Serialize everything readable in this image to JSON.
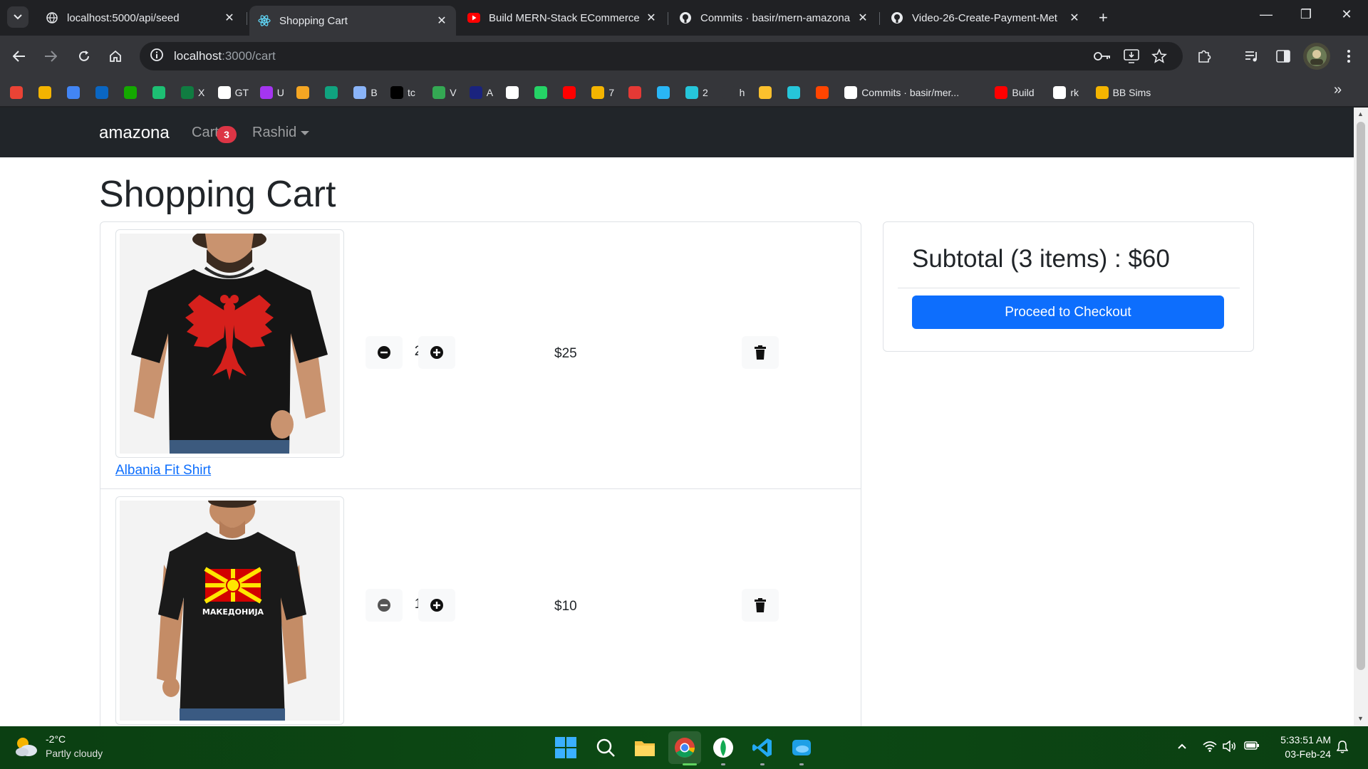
{
  "browser": {
    "tabs": [
      {
        "title": "localhost:5000/api/seed",
        "active": false,
        "icon": "globe-icon"
      },
      {
        "title": "Shopping Cart",
        "active": true,
        "icon": "react-icon"
      },
      {
        "title": "Build MERN-Stack ECommerce",
        "active": false,
        "icon": "youtube-icon"
      },
      {
        "title": "Commits · basir/mern-amazona",
        "active": false,
        "icon": "github-icon"
      },
      {
        "title": "Video-26-Create-Payment-Met",
        "active": false,
        "icon": "github-icon"
      }
    ],
    "url_host": "localhost",
    "url_path": ":3000/cart",
    "bookmarks": [
      {
        "label": "",
        "icon": "gmail-icon",
        "color": "#ea4335"
      },
      {
        "label": "",
        "icon": "photos-icon",
        "color": "#f4b400"
      },
      {
        "label": "",
        "icon": "drive-icon",
        "color": "#4285f4"
      },
      {
        "label": "",
        "icon": "linkedin-icon",
        "color": "#0a66c2"
      },
      {
        "label": "",
        "icon": "upwork-icon",
        "color": "#14a800"
      },
      {
        "label": "",
        "icon": "fiverr-icon",
        "color": "#1dbf73"
      },
      {
        "label": "X",
        "icon": "excel-icon",
        "color": "#107c41"
      },
      {
        "label": "GT",
        "icon": "google-icon",
        "color": "#ffffff"
      },
      {
        "label": "U",
        "icon": "udemy-icon",
        "color": "#a435f0"
      },
      {
        "label": "",
        "icon": "coursera-icon",
        "color": "#f5a623"
      },
      {
        "label": "",
        "icon": "chatgpt-icon",
        "color": "#10a37f"
      },
      {
        "label": "B",
        "icon": "gemini-icon",
        "color": "#8ab4f8"
      },
      {
        "label": "tc",
        "icon": "tc-icon",
        "color": "#000000"
      },
      {
        "label": "V",
        "icon": "download-icon",
        "color": "#34a853"
      },
      {
        "label": "A",
        "icon": "a-icon",
        "color": "#1a237e"
      },
      {
        "label": "",
        "icon": "circle-icon",
        "color": "#ffffff"
      },
      {
        "label": "",
        "icon": "whatsapp-icon",
        "color": "#25d366"
      },
      {
        "label": "",
        "icon": "youtube-icon",
        "color": "#ff0000"
      },
      {
        "label": "7",
        "icon": "play-box-icon",
        "color": "#f4b400"
      },
      {
        "label": "",
        "icon": "play-red-icon",
        "color": "#e53935"
      },
      {
        "label": "",
        "icon": "play-blue-icon",
        "color": "#29b6f6"
      },
      {
        "label": "2",
        "icon": "play-cyan-icon",
        "color": "#26c6da"
      },
      {
        "label": "h",
        "icon": "script-icon",
        "color": "#35363a"
      },
      {
        "label": "",
        "icon": "coin-icon",
        "color": "#fbc02d"
      },
      {
        "label": "",
        "icon": "s-icon",
        "color": "#26c6da"
      },
      {
        "label": "",
        "icon": "reddit-icon",
        "color": "#ff4500"
      },
      {
        "label": "Commits · basir/mer...",
        "icon": "github-icon",
        "color": "#ffffff"
      },
      {
        "label": "Build",
        "icon": "youtube-icon",
        "color": "#ff0000"
      },
      {
        "label": "rk",
        "icon": "github-icon",
        "color": "#ffffff"
      },
      {
        "label": "BB Sims",
        "icon": "sun-icon",
        "color": "#f4b400"
      }
    ]
  },
  "site": {
    "brand": "amazona",
    "cart_label": "Cart",
    "cart_count": "3",
    "user_name": "Rashid"
  },
  "page": {
    "title": "Shopping Cart",
    "items": [
      {
        "name": "Albania Fit Shirt",
        "quantity": "2",
        "price": "$25",
        "flag": "albania"
      },
      {
        "name": "",
        "quantity": "1",
        "price": "$10",
        "flag": "macedonia",
        "shirt_text": "МАКЕДОНИЈА"
      }
    ],
    "subtotal": "Subtotal (3 items) : $60",
    "checkout_label": "Proceed to Checkout"
  },
  "taskbar": {
    "temperature": "-2°C",
    "weather": "Partly cloudy",
    "time": "5:33:51 AM",
    "date": "03-Feb-24"
  },
  "colors": {
    "navbar": "#212529",
    "primary": "#0d6efd",
    "danger": "#dc3545"
  }
}
